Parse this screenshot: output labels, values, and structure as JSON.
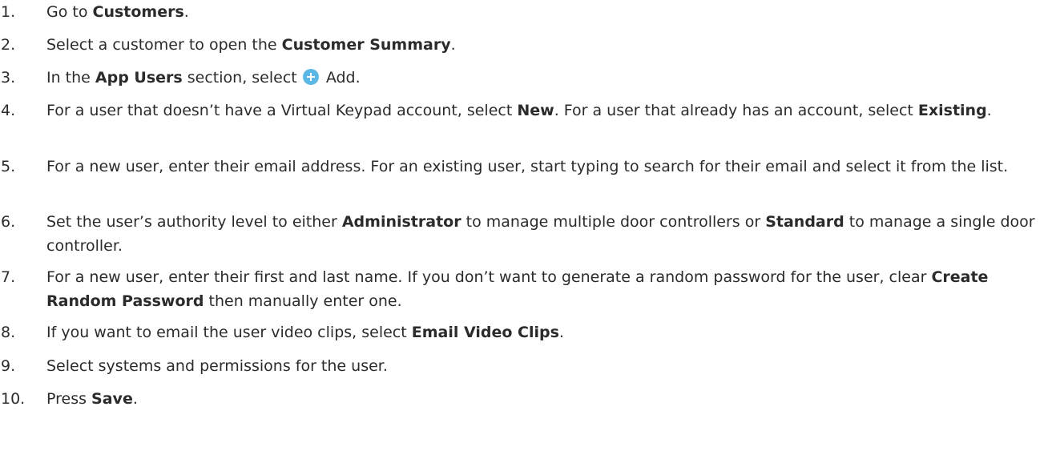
{
  "accent_color": "#5bb7e5",
  "steps": [
    {
      "number": "1.",
      "parts": [
        {
          "t": "Go to "
        },
        {
          "t": "Customers",
          "b": true
        },
        {
          "t": "."
        }
      ]
    },
    {
      "number": "2.",
      "parts": [
        {
          "t": "Select a customer to open the "
        },
        {
          "t": "Customer Summary",
          "b": true
        },
        {
          "t": "."
        }
      ]
    },
    {
      "number": "3.",
      "parts": [
        {
          "t": "In the "
        },
        {
          "t": "App Users",
          "b": true
        },
        {
          "t": " section, select "
        },
        {
          "icon": "add-icon"
        },
        {
          "t": " Add."
        }
      ]
    },
    {
      "number": "4.",
      "parts": [
        {
          "t": "For a user that doesn’t have a Virtual Keypad account, select "
        },
        {
          "t": "New",
          "b": true
        },
        {
          "t": ". For a user that already has an account, select "
        },
        {
          "t": "Existing",
          "b": true
        },
        {
          "t": "."
        }
      ]
    },
    {
      "number": "5.",
      "parts": [
        {
          "t": "For a new user, enter their email address. For an existing user, start typing to search for their email and select it from the list."
        }
      ]
    },
    {
      "number": "6.",
      "parts": [
        {
          "t": "Set the user’s authority level to either "
        },
        {
          "t": "Administrator",
          "b": true
        },
        {
          "t": " to manage multiple door controllers or "
        },
        {
          "t": "Standard",
          "b": true
        },
        {
          "t": " to manage a single door controller."
        }
      ]
    },
    {
      "number": "7.",
      "parts": [
        {
          "t": "For a new user, enter their first and last name. If you don’t want to generate a random password for the user, clear "
        },
        {
          "t": "Create Random Password",
          "b": true
        },
        {
          "t": " then manually enter one."
        }
      ]
    },
    {
      "number": "8.",
      "parts": [
        {
          "t": "If you want to email the user video clips, select "
        },
        {
          "t": "Email Video Clips",
          "b": true
        },
        {
          "t": "."
        }
      ]
    },
    {
      "number": "9.",
      "parts": [
        {
          "t": "Select systems and permissions for the user."
        }
      ]
    },
    {
      "number": "10.",
      "parts": [
        {
          "t": "Press "
        },
        {
          "t": "Save",
          "b": true
        },
        {
          "t": "."
        }
      ]
    }
  ]
}
